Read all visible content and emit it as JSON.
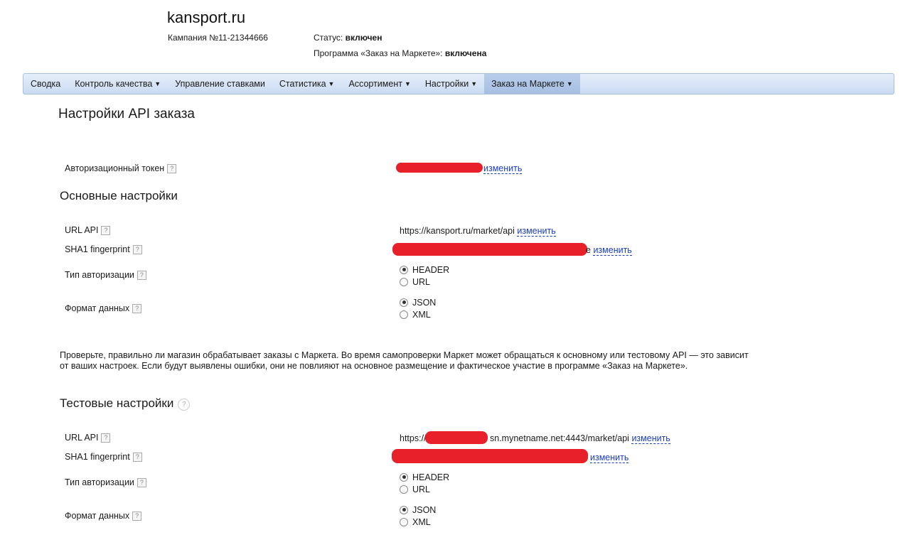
{
  "header": {
    "site": "kansport.ru",
    "campaign": "Кампания №11-21344666",
    "status_label": "Статус:",
    "status_value": "включен",
    "program_label": "Программа «Заказ на Маркете»:",
    "program_value": "включена"
  },
  "nav": [
    {
      "label": "Сводка",
      "has_menu": false
    },
    {
      "label": "Контроль качества",
      "has_menu": true
    },
    {
      "label": "Управление ставками",
      "has_menu": false
    },
    {
      "label": "Статистика",
      "has_menu": true
    },
    {
      "label": "Ассортимент",
      "has_menu": true
    },
    {
      "label": "Настройки",
      "has_menu": true
    },
    {
      "label": "Заказ на Маркете",
      "has_menu": true,
      "active": true
    }
  ],
  "page": {
    "title": "Настройки API заказа",
    "token_label": "Авторизационный токен",
    "change_label": "изменить",
    "main_title": "Основные настройки",
    "test_title": "Тестовые настройки",
    "note": "Проверьте, правильно ли магазин обрабатывает заказы с Маркета. Во время самопроверки Маркет может обращаться к основному или тестовому API — это зависит от ваших настроек. Если будут выявлены ошибки, они не повлияют на основное размещение и фактическое участие в программе «Заказ на Маркете»."
  },
  "main_settings": {
    "url_label": "URL API",
    "url_value": "https://kansport.ru/market/api",
    "sha_label": "SHA1 fingerprint",
    "sha_tail": "e",
    "auth_label": "Тип авторизации",
    "auth_options": [
      "HEADER",
      "URL"
    ],
    "auth_selected": "HEADER",
    "format_label": "Формат данных",
    "format_options": [
      "JSON",
      "XML"
    ],
    "format_selected": "JSON"
  },
  "test_settings": {
    "url_label": "URL API",
    "url_prefix": "https://",
    "url_suffix": "sn.mynetname.net:4443/market/api",
    "sha_label": "SHA1 fingerprint",
    "auth_label": "Тип авторизации",
    "auth_options": [
      "HEADER",
      "URL"
    ],
    "auth_selected": "HEADER",
    "format_label": "Формат данных",
    "format_options": [
      "JSON",
      "XML"
    ],
    "format_selected": "JSON"
  },
  "help_glyph": "?",
  "colors": {
    "link": "#1a3dc1",
    "redaction": "#e8202a",
    "nav_bg": "#c9dbf2"
  }
}
